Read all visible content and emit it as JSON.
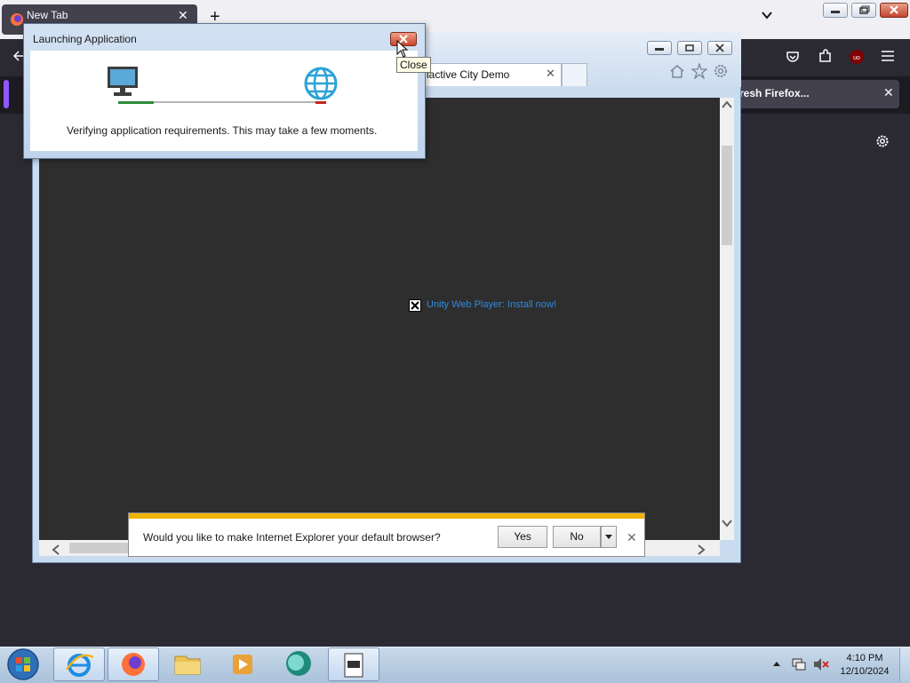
{
  "firefox": {
    "tab_title": "New Tab",
    "tab_close": "✕",
    "new_tab": "+",
    "banner_text": "resh Firefox...",
    "banner_close": "✕"
  },
  "ie": {
    "tab_label": "lactive City Demo",
    "tab_close": "✕",
    "plugin_link": "Unity Web Player: Install now!"
  },
  "notification": {
    "message": "Would you like to make Internet Explorer your default browser?",
    "yes_label": "Yes",
    "no_label": "No",
    "close": "✕"
  },
  "dialog": {
    "title": "Launching Application",
    "message": "Verifying application requirements. This may take a few moments.",
    "close_tooltip": "Close"
  },
  "taskbar": {
    "time": "4:10 PM",
    "date": "12/10/2024"
  },
  "colors": {
    "progress_ok": "#2e8b3d",
    "progress_err": "#c0271d",
    "notif_stripe": "#f0b400",
    "link": "#2f8ae2"
  }
}
